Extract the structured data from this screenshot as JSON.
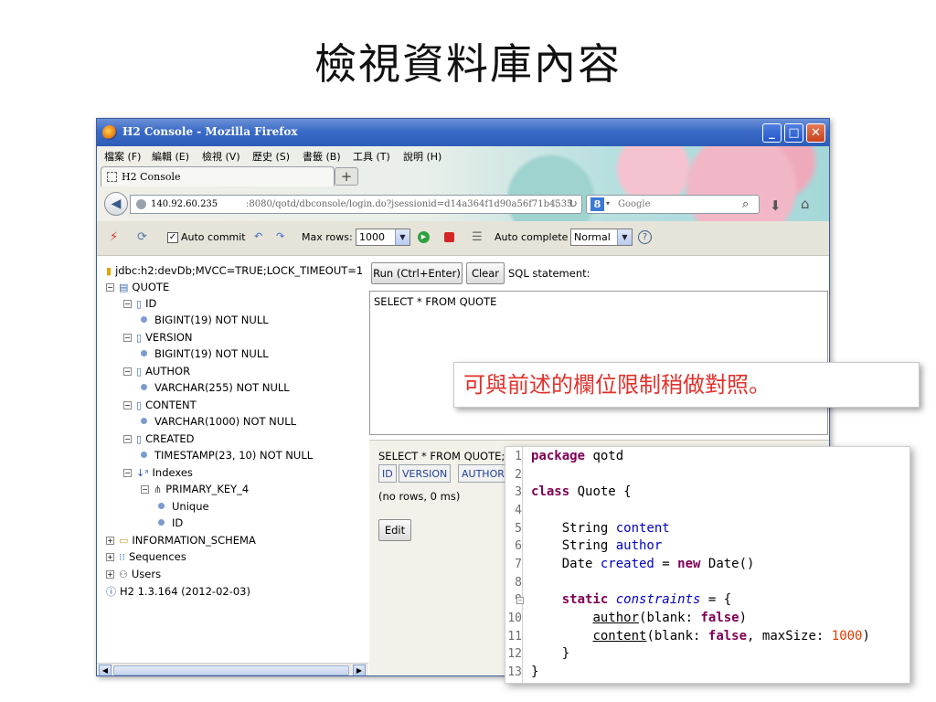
{
  "slide": {
    "title": "檢視資料庫內容",
    "callout": "可與前述的欄位限制稍做對照。"
  },
  "browser": {
    "window_title": "H2 Console - Mozilla Firefox",
    "menu": [
      "檔案 (F)",
      "編輯 (E)",
      "檢視 (V)",
      "歷史 (S)",
      "書籤 (B)",
      "工具 (T)",
      "說明 (H)"
    ],
    "tab_label": "H2 Console",
    "new_tab": "+",
    "url_host": "140.92.60.235",
    "url_path": ":8080/qotd/dbconsole/login.do?jsessionid=d14a364f1d90a56f71b4535",
    "search_placeholder": "Google",
    "search_engine_letter": "8"
  },
  "h2": {
    "auto_commit_label": "Auto commit",
    "auto_commit_checked": "✓",
    "max_rows_label": "Max rows:",
    "max_rows_value": "1000",
    "auto_complete_label": "Auto complete",
    "auto_complete_value": "Normal",
    "help": "?",
    "tree": [
      {
        "text": "jdbc:h2:devDb;MVCC=TRUE;LOCK_TIMEOUT=1",
        "icon": "database-icon"
      },
      {
        "text": "QUOTE",
        "icon": "table-icon"
      },
      {
        "text": "ID",
        "icon": "column-icon"
      },
      {
        "text": "BIGINT(19) NOT NULL",
        "icon": "bullet-icon"
      },
      {
        "text": "VERSION",
        "icon": "column-icon"
      },
      {
        "text": "BIGINT(19) NOT NULL",
        "icon": "bullet-icon"
      },
      {
        "text": "AUTHOR",
        "icon": "column-icon"
      },
      {
        "text": "VARCHAR(255) NOT NULL",
        "icon": "bullet-icon"
      },
      {
        "text": "CONTENT",
        "icon": "column-icon"
      },
      {
        "text": "VARCHAR(1000) NOT NULL",
        "icon": "bullet-icon"
      },
      {
        "text": "CREATED",
        "icon": "column-icon"
      },
      {
        "text": "TIMESTAMP(23, 10) NOT NULL",
        "icon": "bullet-icon"
      },
      {
        "text": "Indexes",
        "icon": "sort-icon"
      },
      {
        "text": "PRIMARY_KEY_4",
        "icon": "index-icon"
      },
      {
        "text": "Unique",
        "icon": "bullet-icon"
      },
      {
        "text": "ID",
        "icon": "bullet-icon"
      },
      {
        "text": "INFORMATION_SCHEMA",
        "icon": "folder-icon"
      },
      {
        "text": "Sequences",
        "icon": "sequence-icon"
      },
      {
        "text": "Users",
        "icon": "users-icon"
      },
      {
        "text": "H2 1.3.164 (2012-02-03)",
        "icon": "info-icon"
      }
    ],
    "run_button": "Run (Ctrl+Enter)",
    "clear_button": "Clear",
    "statement_label": "SQL statement:",
    "sql_text": "SELECT * FROM QUOTE",
    "result_query": "SELECT * FROM QUOTE;",
    "result_columns": [
      "ID",
      "VERSION",
      "AUTHOR"
    ],
    "no_rows": "(no rows, 0 ms)",
    "edit_button": "Edit"
  },
  "code": {
    "line_numbers": [
      "1",
      "2",
      "3",
      "4",
      "5",
      "6",
      "7",
      "8",
      "9",
      "10",
      "11",
      "12",
      "13"
    ],
    "l1_kw": "package",
    "l1_rest": " qotd",
    "l3_kw": "class",
    "l3_rest": " Quote {",
    "l5_type": "    String ",
    "l5_field": "content",
    "l6_type": "    String ",
    "l6_field": "author",
    "l7_type": "    Date ",
    "l7_field": "created",
    "l7_eq": " = ",
    "l7_new": "new",
    "l7_rest": " Date()",
    "l9_indent": "    ",
    "l9_kw": "static",
    "l9_sp": " ",
    "l9_field": "constraints",
    "l9_rest": " = {",
    "l10_indent": "        ",
    "l10_name": "author",
    "l10_mid": "(blank: ",
    "l10_val": "false",
    "l10_end": ")",
    "l11_indent": "        ",
    "l11_name": "content",
    "l11_mid": "(blank: ",
    "l11_val": "false",
    "l11_mid2": ", maxSize: ",
    "l11_num": "1000",
    "l11_end": ")",
    "l12_text": "    }",
    "l13_text": "}"
  }
}
